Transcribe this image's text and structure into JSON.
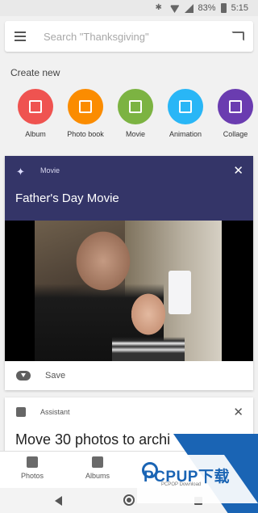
{
  "status_bar": {
    "battery": "83%",
    "time": "5:15"
  },
  "search": {
    "placeholder": "Search \"Thanksgiving\""
  },
  "create_new": {
    "heading": "Create new",
    "items": [
      {
        "label": "Album",
        "color": "#ef5350",
        "icon": "album-icon"
      },
      {
        "label": "Photo book",
        "color": "#fb8c00",
        "icon": "photo-book-icon"
      },
      {
        "label": "Movie",
        "color": "#7cb342",
        "icon": "movie-icon"
      },
      {
        "label": "Animation",
        "color": "#29b6f6",
        "icon": "animation-icon"
      },
      {
        "label": "Collage",
        "color": "#6a3cb0",
        "icon": "collage-icon"
      }
    ]
  },
  "movie_card": {
    "type_label": "Movie",
    "title": "Father's Day Movie",
    "save_label": "Save",
    "header_color": "#343568"
  },
  "assistant_card": {
    "label": "Assistant",
    "title": "Move 30 photos to archi"
  },
  "bottom_nav": {
    "items": [
      {
        "label": "Photos",
        "icon": "photos-icon"
      },
      {
        "label": "Albums",
        "icon": "albums-icon"
      }
    ]
  },
  "watermark": {
    "text": "PCPUP下载",
    "sub": "PCPOP Download"
  }
}
